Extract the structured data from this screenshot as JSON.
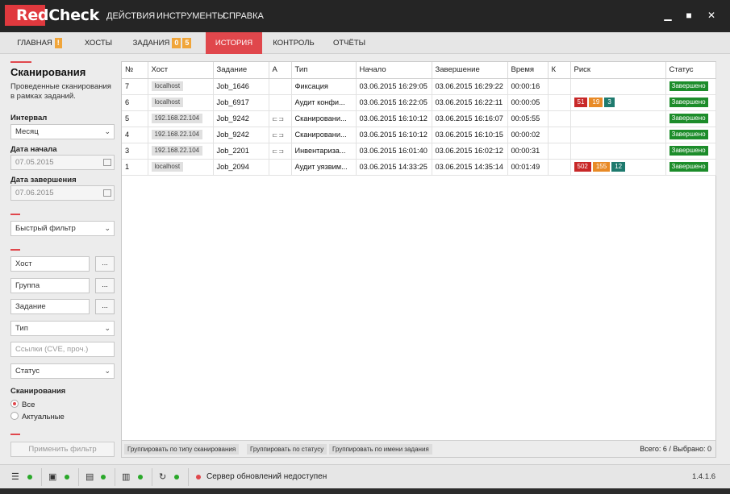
{
  "app": {
    "logo_red": "Red",
    "logo_rest": "Check"
  },
  "menu": [
    "ДЕЙСТВИЯ",
    "ИНСТРУМЕНТЫ",
    "СПРАВКА"
  ],
  "tabs": {
    "main": {
      "label": "ГЛАВНАЯ",
      "badge": "!"
    },
    "hosts": {
      "label": "ХОСТЫ"
    },
    "tasks": {
      "label": "ЗАДАНИЯ",
      "badge1": "0",
      "badge2": "5"
    },
    "history": {
      "label": "ИСТОРИЯ"
    },
    "control": {
      "label": "КОНТРОЛЬ"
    },
    "reports": {
      "label": "ОТЧЁТЫ"
    }
  },
  "sidebar": {
    "title": "Сканирования",
    "description": "Проведенные сканирования в рамках заданий.",
    "interval_label": "Интервал",
    "interval_value": "Месяц",
    "date_start_label": "Дата начала",
    "date_start_value": "07.05.2015",
    "date_end_label": "Дата завершения",
    "date_end_value": "07.06.2015",
    "quick_filter": "Быстрый фильтр",
    "host_placeholder": "Хост",
    "group_placeholder": "Группа",
    "task_placeholder": "Задание",
    "type_select": "Тип",
    "links_placeholder": "Ссылки (CVE, проч.)",
    "status_select": "Статус",
    "scans_label": "Сканирования",
    "radio_all": "Все",
    "radio_actual": "Актуальные",
    "dots": "...",
    "apply_button": "Применить фильтр"
  },
  "table": {
    "columns": [
      "№",
      "Хост",
      "Задание",
      "А",
      "Тип",
      "Начало",
      "Завершение",
      "Время",
      "К",
      "Риск",
      "Статус"
    ],
    "rows": [
      {
        "num": "7",
        "host": "localhost",
        "task": "Job_1646",
        "a": "",
        "type": "Фиксация",
        "start": "03.06.2015 16:29:05",
        "end": "03.06.2015 16:29:22",
        "time": "00:00:16",
        "k": "",
        "risk": [],
        "status": "Завершено"
      },
      {
        "num": "6",
        "host": "localhost",
        "task": "Job_6917",
        "a": "",
        "type": "Аудит конфи...",
        "start": "03.06.2015 16:22:05",
        "end": "03.06.2015 16:22:11",
        "time": "00:00:05",
        "k": "",
        "risk": [
          "51",
          "19",
          "3"
        ],
        "status": "Завершено"
      },
      {
        "num": "5",
        "host": "192.168.22.104",
        "task": "Job_9242",
        "a": "⊏⊐",
        "type": "Сканировани...",
        "start": "03.06.2015 16:10:12",
        "end": "03.06.2015 16:16:07",
        "time": "00:05:55",
        "k": "",
        "risk": [],
        "status": "Завершено"
      },
      {
        "num": "4",
        "host": "192.168.22.104",
        "task": "Job_9242",
        "a": "⊏⊐",
        "type": "Сканировани...",
        "start": "03.06.2015 16:10:12",
        "end": "03.06.2015 16:10:15",
        "time": "00:00:02",
        "k": "",
        "risk": [],
        "status": "Завершено"
      },
      {
        "num": "3",
        "host": "192.168.22.104",
        "task": "Job_2201",
        "a": "⊏⊐",
        "type": "Инвентаризa...",
        "start": "03.06.2015 16:01:40",
        "end": "03.06.2015 16:02:12",
        "time": "00:00:31",
        "k": "",
        "risk": [],
        "status": "Завершено"
      },
      {
        "num": "1",
        "host": "localhost",
        "task": "Job_2094",
        "a": "",
        "type": "Аудит уязвим...",
        "start": "03.06.2015 14:33:25",
        "end": "03.06.2015 14:35:14",
        "time": "00:01:49",
        "k": "",
        "risk": [
          "502",
          "155",
          "12"
        ],
        "status": "Завершено"
      }
    ]
  },
  "groupbar": {
    "by_type": "Группировать по типу сканирования",
    "by_status": "Группировать по статусу",
    "by_name": "Группировать по имени задания",
    "total": "Всего: 6 / Выбрано: 0"
  },
  "statusbar": {
    "server_message": "Сервер обновлений недоступен",
    "version": "1.4.1.6"
  },
  "colors": {
    "accent": "#e0474c",
    "status_ok": "#1c8c2a",
    "risk_high": "#c82828",
    "risk_medium": "#e88a26",
    "risk_low": "#1e7a6e"
  }
}
